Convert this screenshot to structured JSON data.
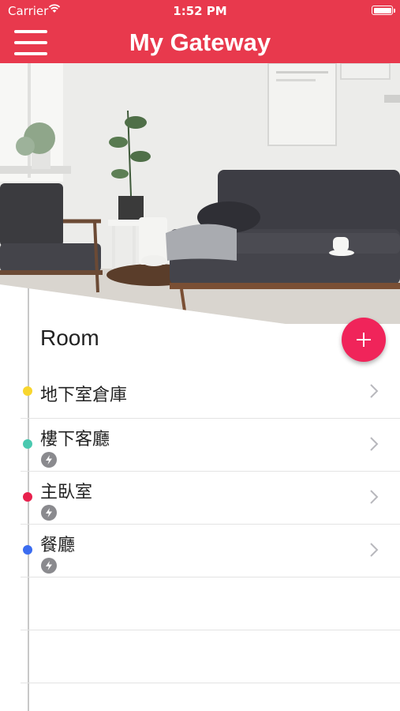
{
  "status_bar": {
    "carrier": "Carrier",
    "time": "1:52 PM"
  },
  "header": {
    "title": "My Gateway",
    "bg_color": "#e8394d"
  },
  "section": {
    "heading": "Room"
  },
  "rooms": [
    {
      "name": "地下室倉庫",
      "color": "#f8d62e",
      "has_device": false
    },
    {
      "name": "樓下客廳",
      "color": "#4ac9b0",
      "has_device": true
    },
    {
      "name": "主臥室",
      "color": "#e8214d",
      "has_device": true
    },
    {
      "name": "餐廳",
      "color": "#3b6cf0",
      "has_device": true
    }
  ],
  "fab": {
    "color": "#f0245a",
    "icon": "plus-icon"
  }
}
